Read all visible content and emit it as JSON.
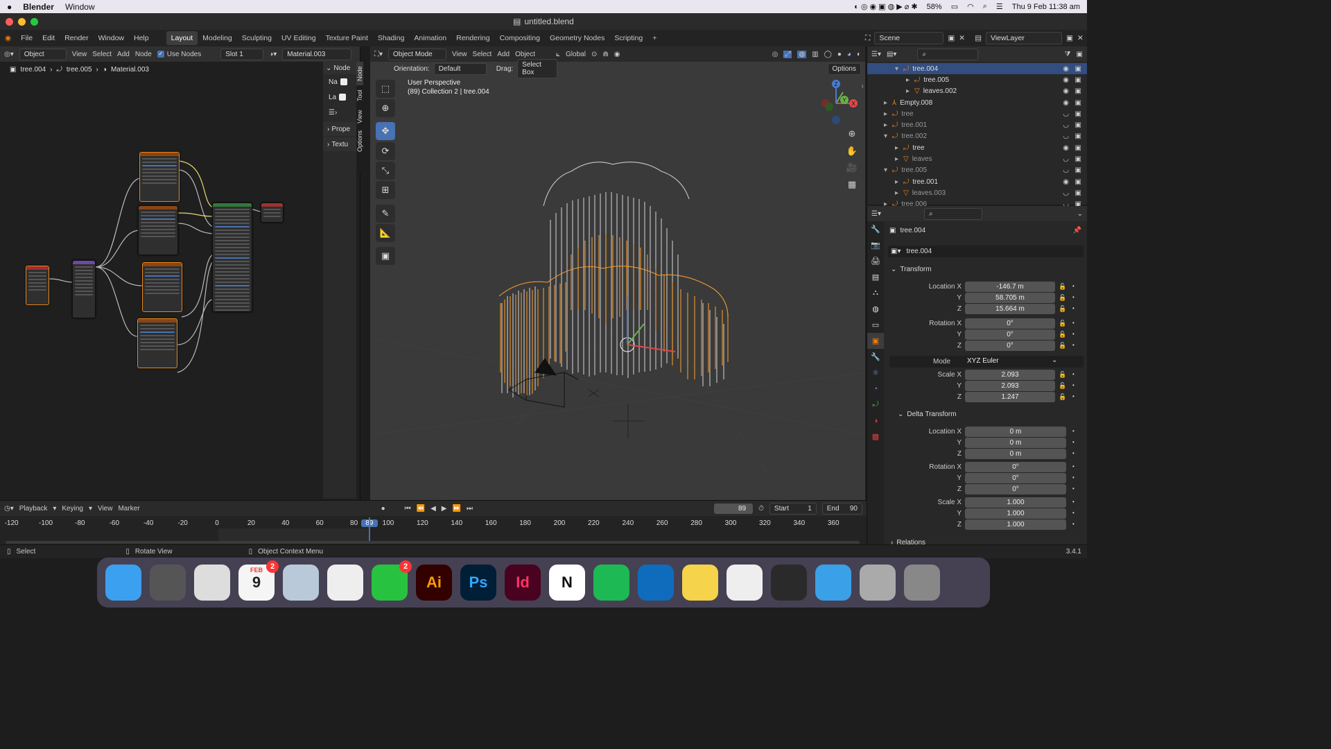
{
  "macos": {
    "apple_icon": "apple-icon",
    "app_name": "Blender",
    "menu": [
      "Window"
    ],
    "battery": "58%",
    "datetime": "Thu 9 Feb  11:38 am"
  },
  "window": {
    "title": "untitled.blend"
  },
  "topbar": {
    "menus": [
      "File",
      "Edit",
      "Render",
      "Window",
      "Help"
    ],
    "workspaces": [
      "Layout",
      "Modeling",
      "Sculpting",
      "UV Editing",
      "Texture Paint",
      "Shading",
      "Animation",
      "Rendering",
      "Compositing",
      "Geometry Nodes",
      "Scripting"
    ],
    "active_workspace": "Layout",
    "scene_label": "Scene",
    "viewlayer_label": "ViewLayer"
  },
  "node_editor": {
    "object_mode": "Object",
    "menus": [
      "View",
      "Select",
      "Add",
      "Node"
    ],
    "use_nodes_label": "Use Nodes",
    "slot": "Slot 1",
    "material": "Material.003",
    "breadcrumb": [
      "tree.004",
      "tree.005",
      "Material.003"
    ],
    "side_tabs": [
      "Node",
      "Tool",
      "View",
      "Options"
    ],
    "panel_header": "Node",
    "panel_rows": [
      "Na",
      "La"
    ],
    "panel_sections": [
      "Prope",
      "Textu"
    ]
  },
  "viewport": {
    "mode": "Object Mode",
    "menus": [
      "View",
      "Select",
      "Add",
      "Object"
    ],
    "transform_orientation": "Global",
    "orientation_label": "Orientation:",
    "orientation_value": "Default",
    "drag_label": "Drag:",
    "drag_value": "Select Box",
    "options_label": "Options",
    "overlay_line1": "User Perspective",
    "overlay_line2": "(89) Collection 2 | tree.004",
    "gizmo_axes": [
      "X",
      "Y",
      "Z"
    ]
  },
  "outliner": {
    "rows": [
      {
        "label": "tree.004",
        "indent": 2,
        "selected": true,
        "expanded": true,
        "icon": "curve-icon"
      },
      {
        "label": "tree.005",
        "indent": 3,
        "icon": "curve-icon"
      },
      {
        "label": "leaves.002",
        "indent": 3,
        "icon": "mesh-icon"
      },
      {
        "label": "Empty.008",
        "indent": 1,
        "icon": "empty-icon"
      },
      {
        "label": "tree",
        "indent": 1,
        "dim": true,
        "icon": "curve-icon"
      },
      {
        "label": "tree.001",
        "indent": 1,
        "dim": true,
        "icon": "curve-icon"
      },
      {
        "label": "tree.002",
        "indent": 1,
        "dim": true,
        "expanded": true,
        "icon": "curve-icon"
      },
      {
        "label": "tree",
        "indent": 2,
        "icon": "curve-icon"
      },
      {
        "label": "leaves",
        "indent": 2,
        "dim": true,
        "icon": "mesh-icon"
      },
      {
        "label": "tree.005",
        "indent": 1,
        "dim": true,
        "expanded": true,
        "icon": "curve-icon"
      },
      {
        "label": "tree.001",
        "indent": 2,
        "icon": "curve-icon"
      },
      {
        "label": "leaves.003",
        "indent": 2,
        "dim": true,
        "icon": "mesh-icon"
      },
      {
        "label": "tree.006",
        "indent": 1,
        "dim": true,
        "icon": "curve-icon"
      }
    ]
  },
  "properties": {
    "object_name": "tree.004",
    "object_field": "tree.004",
    "transform_header": "Transform",
    "location": {
      "x": "-146.7 m",
      "y": "58.705 m",
      "z": "15.664 m"
    },
    "rotation": {
      "x": "0°",
      "y": "0°",
      "z": "0°"
    },
    "mode_label": "Mode",
    "mode_value": "XYZ Euler",
    "scale": {
      "x": "2.093",
      "y": "2.093",
      "z": "1.247"
    },
    "delta_header": "Delta Transform",
    "delta_location": {
      "x": "0 m",
      "y": "0 m",
      "z": "0 m"
    },
    "delta_rotation": {
      "x": "0°",
      "y": "0°",
      "z": "0°"
    },
    "delta_scale": {
      "x": "1.000",
      "y": "1.000",
      "z": "1.000"
    },
    "relations_header": "Relations",
    "labels": {
      "location_x": "Location X",
      "rotation_x": "Rotation X",
      "scale_x": "Scale X",
      "y": "Y",
      "z": "Z"
    }
  },
  "timeline": {
    "menus": [
      "Playback",
      "Keying",
      "View",
      "Marker"
    ],
    "current_frame": "89",
    "start_label": "Start",
    "start": "1",
    "end_label": "End",
    "end": "90",
    "ticks": [
      "-120",
      "-100",
      "-80",
      "-60",
      "-40",
      "-20",
      "0",
      "20",
      "40",
      "60",
      "80",
      "89",
      "100",
      "120",
      "140",
      "160",
      "180",
      "200",
      "220",
      "240",
      "260",
      "280",
      "300",
      "320",
      "340",
      "360"
    ]
  },
  "statusbar": {
    "items": [
      "Select",
      "Rotate View",
      "Object Context Menu"
    ],
    "version": "3.4.1"
  },
  "dock": {
    "apps": [
      {
        "name": "finder",
        "label": "",
        "color": "#3ba0f0"
      },
      {
        "name": "calculator",
        "label": "",
        "color": "#555"
      },
      {
        "name": "launchpad",
        "label": "",
        "color": "#ddd"
      },
      {
        "name": "calendar",
        "label": "9",
        "month": "FEB",
        "color": "#f5f5f5",
        "badge": "2"
      },
      {
        "name": "preview",
        "label": "",
        "color": "#b9c9d9"
      },
      {
        "name": "chrome",
        "label": "",
        "color": "#eee"
      },
      {
        "name": "whatsapp",
        "label": "",
        "color": "#27c23f",
        "badge": "2"
      },
      {
        "name": "illustrator",
        "label": "Ai",
        "color": "#330000"
      },
      {
        "name": "photoshop",
        "label": "Ps",
        "color": "#001e36"
      },
      {
        "name": "indesign",
        "label": "Id",
        "color": "#49021f"
      },
      {
        "name": "notion",
        "label": "N",
        "color": "#ffffff"
      },
      {
        "name": "spotify",
        "label": "",
        "color": "#1db954"
      },
      {
        "name": "outlook",
        "label": "",
        "color": "#0f6cbd"
      },
      {
        "name": "notes",
        "label": "",
        "color": "#f5d34a"
      },
      {
        "name": "unity",
        "label": "",
        "color": "#eee"
      },
      {
        "name": "blender",
        "label": "",
        "color": "#2a2a2a"
      },
      {
        "name": "files",
        "label": "",
        "color": "#3aa0e8"
      },
      {
        "name": "chrome-window",
        "label": "",
        "color": "#aaa"
      },
      {
        "name": "trash",
        "label": "",
        "color": "#888"
      }
    ]
  }
}
